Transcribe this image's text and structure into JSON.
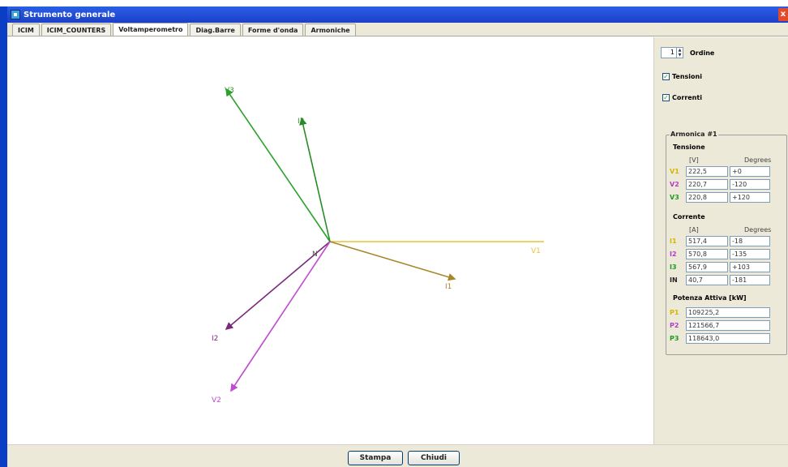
{
  "window": {
    "title": "Strumento generale",
    "close_glyph": "x"
  },
  "tabs": [
    {
      "label": "ICIM",
      "active": false
    },
    {
      "label": "ICIM_COUNTERS",
      "active": false
    },
    {
      "label": "Voltamperometro",
      "active": true
    },
    {
      "label": "Diag.Barre",
      "active": false
    },
    {
      "label": "Forme d'onda",
      "active": false
    },
    {
      "label": "Armoniche",
      "active": false
    }
  ],
  "phasor_diagram": {
    "origin_label": "N",
    "vectors": [
      {
        "name": "V1",
        "color": "#e8c23a",
        "arrow": false
      },
      {
        "name": "V2",
        "color": "#c04ad0",
        "arrow": true
      },
      {
        "name": "V3",
        "color": "#2aa22a",
        "arrow": true
      },
      {
        "name": "I1",
        "color": "#a8862a",
        "arrow": true
      },
      {
        "name": "I2",
        "color": "#7a2a7a",
        "arrow": true
      },
      {
        "name": "I3",
        "color": "#2a8a2a",
        "arrow": true
      }
    ]
  },
  "controls": {
    "order_value": "1",
    "order_label": "Ordine",
    "voltages_check": {
      "label": "Tensioni",
      "checked": true
    },
    "currents_check": {
      "label": "Correnti",
      "checked": true
    }
  },
  "harmonic_panel": {
    "legend": "Armonica #1",
    "voltage": {
      "title": "Tensione",
      "unit_header": "[V]",
      "angle_header": "Degrees",
      "rows": [
        {
          "label": "V1",
          "color": "#d6b400",
          "value": "222,5",
          "angle": "+0"
        },
        {
          "label": "V2",
          "color": "#b43cc4",
          "value": "220,7",
          "angle": "-120"
        },
        {
          "label": "V3",
          "color": "#1f9a1f",
          "value": "220,8",
          "angle": "+120"
        }
      ]
    },
    "current": {
      "title": "Corrente",
      "unit_header": "[A]",
      "angle_header": "Degrees",
      "rows": [
        {
          "label": "I1",
          "color": "#d6b400",
          "value": "517,4",
          "angle": "-18"
        },
        {
          "label": "I2",
          "color": "#b43cc4",
          "value": "570,8",
          "angle": "-135"
        },
        {
          "label": "I3",
          "color": "#1f9a1f",
          "value": "567,9",
          "angle": "+103"
        },
        {
          "label": "IN",
          "color": "#222222",
          "value": "40,7",
          "angle": "-181"
        }
      ]
    },
    "power": {
      "title": "Potenza Attiva [kW]",
      "rows": [
        {
          "label": "P1",
          "color": "#d6b400",
          "value": "109225,2"
        },
        {
          "label": "P2",
          "color": "#b43cc4",
          "value": "121566,7"
        },
        {
          "label": "P3",
          "color": "#1f9a1f",
          "value": "118643,0"
        }
      ]
    }
  },
  "buttons": {
    "print": "Stampa",
    "close": "Chiudi"
  }
}
